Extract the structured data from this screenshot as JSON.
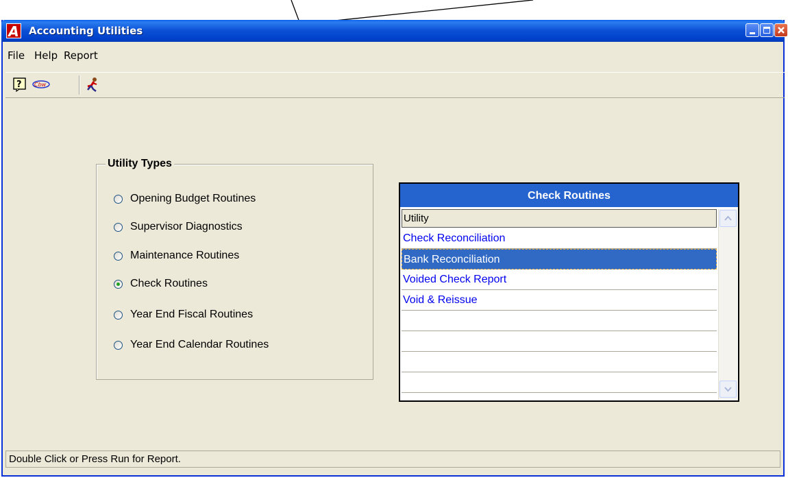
{
  "window": {
    "title": "Accounting Utilities",
    "app_icon_letter": "A"
  },
  "menu": {
    "items": [
      "File",
      "Help",
      "Report"
    ]
  },
  "toolbar": {
    "icons": [
      "help-icon",
      "logo-icon",
      "run-icon"
    ],
    "logo_text": "Cbw"
  },
  "utility_types": {
    "title": "Utility Types",
    "options": [
      {
        "label": "Opening Budget Routines",
        "selected": false
      },
      {
        "label": "Supervisor Diagnostics",
        "selected": false
      },
      {
        "label": "Maintenance Routines",
        "selected": false
      },
      {
        "label": "Check Routines",
        "selected": true
      },
      {
        "label": "Year End Fiscal Routines",
        "selected": false
      },
      {
        "label": "Year End Calendar Routines",
        "selected": false
      }
    ]
  },
  "routines_panel": {
    "title": "Check Routines",
    "column_header": "Utility",
    "rows": [
      "Check Reconciliation",
      "Bank Reconciliation",
      "Voided Check Report",
      "Void & Reissue",
      "",
      "",
      "",
      ""
    ],
    "selected_row": "Bank Reconciliation"
  },
  "status_bar": {
    "text": "Double Click or Press Run for Report."
  },
  "colors": {
    "title_bar": "#0a4fd5",
    "panel_header": "#2563cf",
    "link_text": "#0000ee",
    "selection": "#316ac5"
  }
}
